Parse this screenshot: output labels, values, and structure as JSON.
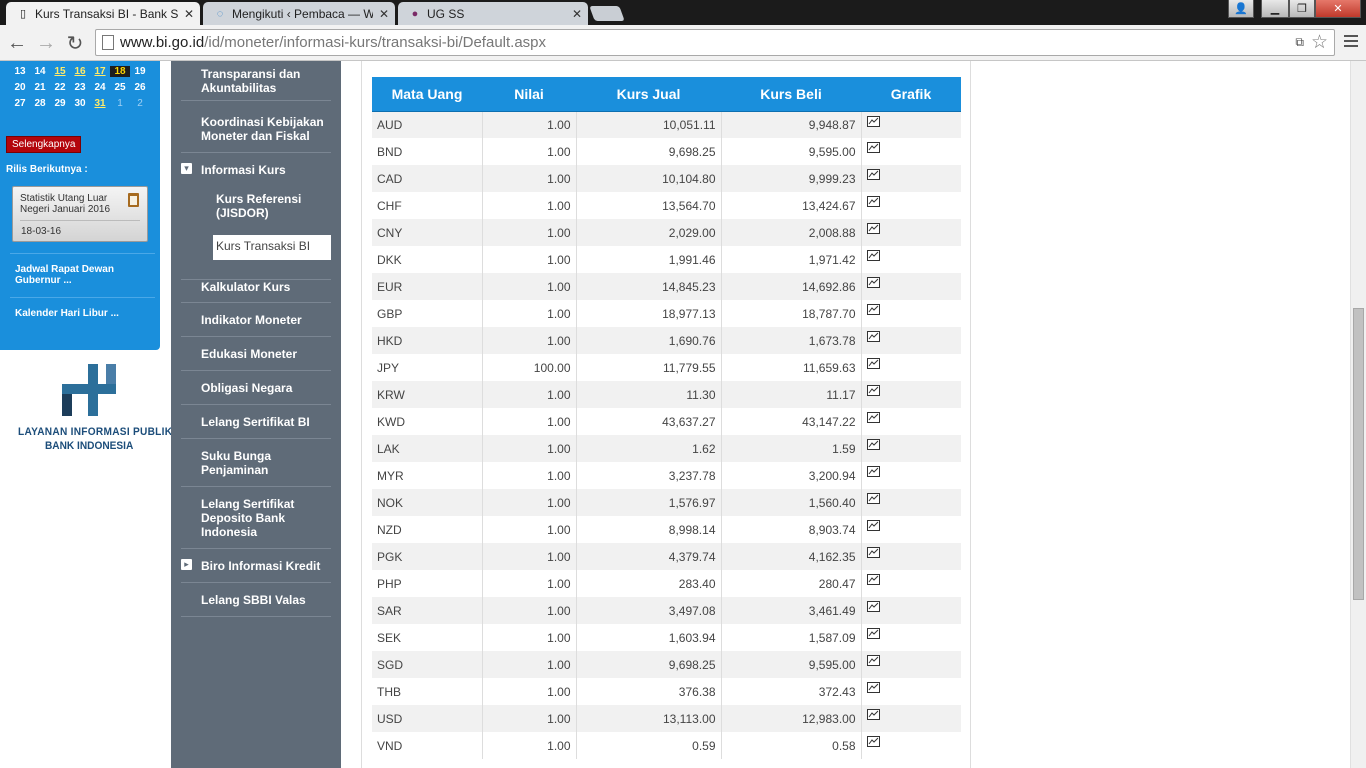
{
  "browser": {
    "tabs": [
      {
        "title": "Kurs Transaksi BI - Bank S",
        "favicon": "page-icon",
        "active": true
      },
      {
        "title": "Mengikuti ‹ Pembaca — W",
        "favicon": "wordpress-icon",
        "active": false
      },
      {
        "title": "UG SS",
        "favicon": "site-icon",
        "active": false
      }
    ],
    "url_host": "www.bi.go.id",
    "url_path": "/id/moneter/informasi-kurs/transaksi-bi/Default.aspx",
    "colors": {
      "tab_bg": "#1b1b1b",
      "accent": "#1a8fdc",
      "nav_bg": "#5f6b78"
    }
  },
  "calendar": {
    "rows": [
      [
        "13",
        "14",
        "15",
        "16",
        "17",
        "18",
        "19"
      ],
      [
        "20",
        "21",
        "22",
        "23",
        "24",
        "25",
        "26"
      ],
      [
        "27",
        "28",
        "29",
        "30",
        "31",
        "1",
        "2"
      ]
    ]
  },
  "left_panel": {
    "more_label": "Selengkapnya",
    "rilis_title": "Rilis Berikutnya :",
    "release_title": "Statistik Utang Luar Negeri Januari 2016",
    "release_date": "18-03-16",
    "link_rapat": "Jadwal Rapat Dewan Gubernur ...",
    "link_libur": "Kalender Hari Libur ...",
    "logo_line1": "LAYANAN INFORMASI PUBLIK",
    "logo_line2": "BANK INDONESIA"
  },
  "nav": {
    "transparansi": "Transparansi dan Akuntabilitas",
    "koordinasi": "Koordinasi Kebijakan Moneter dan Fiskal",
    "informasi_kurs": "Informasi Kurs",
    "kurs_referensi": "Kurs Referensi (JISDOR)",
    "kurs_transaksi": "Kurs Transaksi BI",
    "kalkulator": "Kalkulator Kurs",
    "indikator": "Indikator Moneter",
    "edukasi": "Edukasi Moneter",
    "obligasi": "Obligasi Negara",
    "lelang_sbi": "Lelang Sertifikat BI",
    "suku_bunga": "Suku Bunga Penjaminan",
    "lelang_deposito": "Lelang Sertifikat Deposito Bank Indonesia",
    "biro": "Biro Informasi Kredit",
    "lelang_sbbi": "Lelang SBBI Valas"
  },
  "table": {
    "headers": [
      "Mata Uang",
      "Nilai",
      "Kurs Jual",
      "Kurs Beli",
      "Grafik"
    ],
    "rows": [
      [
        "AUD",
        "1.00",
        "10,051.11",
        "9,948.87"
      ],
      [
        "BND",
        "1.00",
        "9,698.25",
        "9,595.00"
      ],
      [
        "CAD",
        "1.00",
        "10,104.80",
        "9,999.23"
      ],
      [
        "CHF",
        "1.00",
        "13,564.70",
        "13,424.67"
      ],
      [
        "CNY",
        "1.00",
        "2,029.00",
        "2,008.88"
      ],
      [
        "DKK",
        "1.00",
        "1,991.46",
        "1,971.42"
      ],
      [
        "EUR",
        "1.00",
        "14,845.23",
        "14,692.86"
      ],
      [
        "GBP",
        "1.00",
        "18,977.13",
        "18,787.70"
      ],
      [
        "HKD",
        "1.00",
        "1,690.76",
        "1,673.78"
      ],
      [
        "JPY",
        "100.00",
        "11,779.55",
        "11,659.63"
      ],
      [
        "KRW",
        "1.00",
        "11.30",
        "11.17"
      ],
      [
        "KWD",
        "1.00",
        "43,637.27",
        "43,147.22"
      ],
      [
        "LAK",
        "1.00",
        "1.62",
        "1.59"
      ],
      [
        "MYR",
        "1.00",
        "3,237.78",
        "3,200.94"
      ],
      [
        "NOK",
        "1.00",
        "1,576.97",
        "1,560.40"
      ],
      [
        "NZD",
        "1.00",
        "8,998.14",
        "8,903.74"
      ],
      [
        "PGK",
        "1.00",
        "4,379.74",
        "4,162.35"
      ],
      [
        "PHP",
        "1.00",
        "283.40",
        "280.47"
      ],
      [
        "SAR",
        "1.00",
        "3,497.08",
        "3,461.49"
      ],
      [
        "SEK",
        "1.00",
        "1,603.94",
        "1,587.09"
      ],
      [
        "SGD",
        "1.00",
        "9,698.25",
        "9,595.00"
      ],
      [
        "THB",
        "1.00",
        "376.38",
        "372.43"
      ],
      [
        "USD",
        "1.00",
        "13,113.00",
        "12,983.00"
      ],
      [
        "VND",
        "1.00",
        "0.59",
        "0.58"
      ]
    ]
  }
}
